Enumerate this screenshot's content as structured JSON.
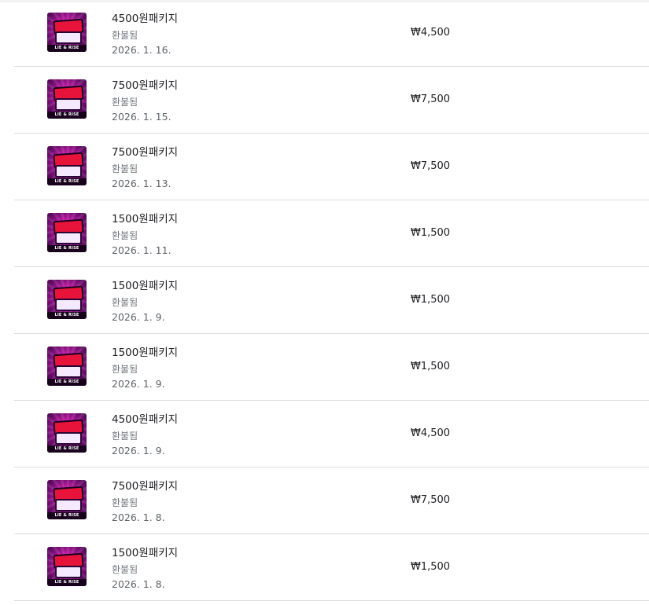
{
  "product_image": {
    "icon": "game-logo-thumbnail",
    "strip_text": "LIE & RISE"
  },
  "purchases": [
    {
      "title": "4500원패키지",
      "status": "환불됨",
      "date": "2026. 1. 16.",
      "price": "₩4,500"
    },
    {
      "title": "7500원패키지",
      "status": "환불됨",
      "date": "2026. 1. 15.",
      "price": "₩7,500"
    },
    {
      "title": "7500원패키지",
      "status": "환불됨",
      "date": "2026. 1. 13.",
      "price": "₩7,500"
    },
    {
      "title": "1500원패키지",
      "status": "환불됨",
      "date": "2026. 1. 11.",
      "price": "₩1,500"
    },
    {
      "title": "1500원패키지",
      "status": "환불됨",
      "date": "2026. 1. 9.",
      "price": "₩1,500"
    },
    {
      "title": "1500원패키지",
      "status": "환불됨",
      "date": "2026. 1. 9.",
      "price": "₩1,500"
    },
    {
      "title": "4500원패키지",
      "status": "환불됨",
      "date": "2026. 1. 9.",
      "price": "₩4,500"
    },
    {
      "title": "7500원패키지",
      "status": "환불됨",
      "date": "2026. 1. 8.",
      "price": "₩7,500"
    },
    {
      "title": "1500원패키지",
      "status": "환불됨",
      "date": "2026. 1. 8.",
      "price": "₩1,500"
    }
  ]
}
